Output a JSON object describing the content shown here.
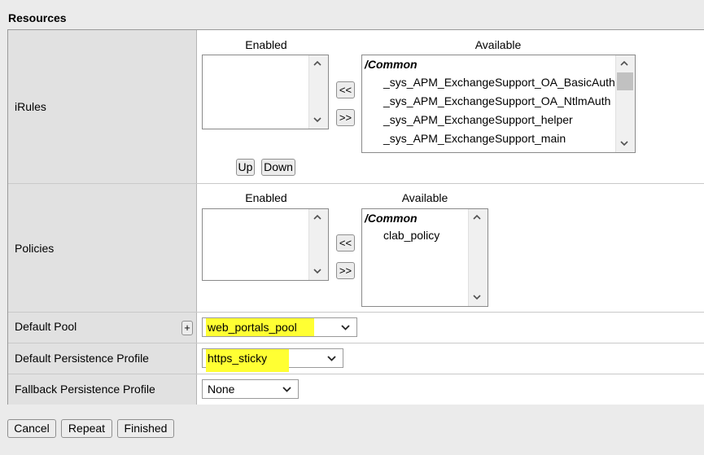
{
  "section_title": "Resources",
  "irules": {
    "label": "iRules",
    "enabled_header": "Enabled",
    "available_header": "Available",
    "available_group": "/Common",
    "available_items": [
      "_sys_APM_ExchangeSupport_OA_BasicAuth",
      "_sys_APM_ExchangeSupport_OA_NtlmAuth",
      "_sys_APM_ExchangeSupport_helper",
      "_sys_APM_ExchangeSupport_main"
    ],
    "move_left_label": "<<",
    "move_right_label": ">>",
    "up_label": "Up",
    "down_label": "Down"
  },
  "policies": {
    "label": "Policies",
    "enabled_header": "Enabled",
    "available_header": "Available",
    "available_group": "/Common",
    "available_items": [
      "clab_policy"
    ],
    "move_left_label": "<<",
    "move_right_label": ">>"
  },
  "default_pool": {
    "label": "Default Pool",
    "add_label": "+",
    "value": "web_portals_pool"
  },
  "default_persistence": {
    "label": "Default Persistence Profile",
    "value": "https_sticky"
  },
  "fallback_persistence": {
    "label": "Fallback Persistence Profile",
    "value": "None"
  },
  "footer": {
    "cancel_label": "Cancel",
    "repeat_label": "Repeat",
    "finished_label": "Finished"
  },
  "colors": {
    "highlight": "#ffff33",
    "label_bg": "#e1e1e1",
    "page_bg": "#ebebeb"
  }
}
